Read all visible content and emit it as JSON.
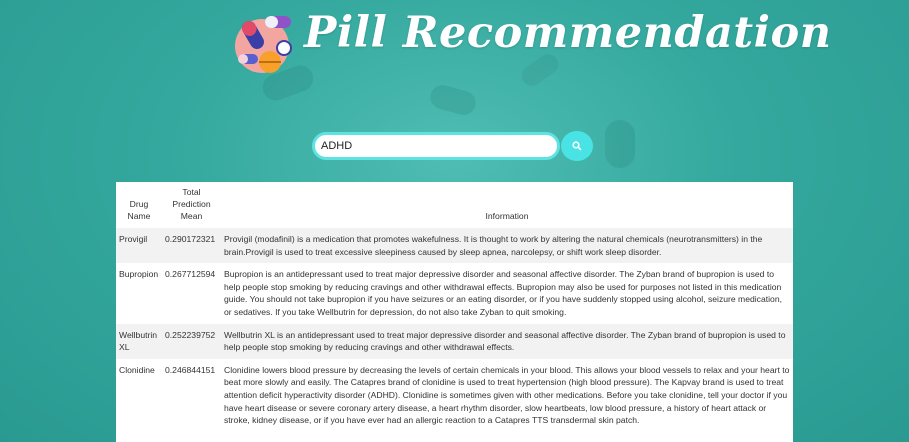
{
  "app": {
    "title": "Pill Recommendation"
  },
  "search": {
    "value": "ADHD",
    "button_icon": "search-icon"
  },
  "table": {
    "headers": [
      "Drug Name",
      "Total Prediction Mean",
      "Information"
    ],
    "rows": [
      {
        "name": "Provigil",
        "score": "0.290172321",
        "info": "Provigil (modafinil) is a medication that promotes wakefulness. It is thought to work by altering the natural chemicals (neurotransmitters) in the brain.Provigil is used to treat excessive sleepiness caused by sleep apnea, narcolepsy, or shift work sleep disorder."
      },
      {
        "name": "Bupropion",
        "score": "0.267712594",
        "info": "Bupropion is an antidepressant used to treat major depressive disorder and seasonal affective disorder. The Zyban brand of bupropion is used to help people stop smoking by reducing cravings and other withdrawal effects. Bupropion may also be used for purposes not listed in this medication guide. You should not take bupropion if you have seizures or an eating disorder, or if you have suddenly stopped using alcohol, seizure medication, or sedatives. If you take Wellbutrin for depression, do not also take Zyban to quit smoking."
      },
      {
        "name": "Wellbutrin XL",
        "score": "0.252239752",
        "info": "Wellbutrin XL is an antidepressant used to treat major depressive disorder and seasonal affective disorder. The Zyban brand of bupropion is used to help people stop smoking by reducing cravings and other withdrawal effects."
      },
      {
        "name": "Clonidine",
        "score": "0.246844151",
        "info": "Clonidine lowers blood pressure by decreasing the levels of certain chemicals in your blood. This allows your blood vessels to relax and your heart to beat more slowly and easily. The Catapres brand of clonidine is used to treat hypertension (high blood pressure). The Kapvay brand is used to treat attention deficit hyperactivity disorder (ADHD). Clonidine is sometimes given with other medications. Before you take clonidine, tell your doctor if you have heart disease or severe coronary artery disease, a heart rhythm disorder, slow heartbeats, low blood pressure, a history of heart attack or stroke, kidney disease, or if you have ever had an allergic reaction to a Catapres TTS transdermal skin patch."
      }
    ]
  },
  "colors": {
    "background": "#34a89e",
    "accent": "#49e3e6",
    "row_alt": "#f2f2f2"
  }
}
